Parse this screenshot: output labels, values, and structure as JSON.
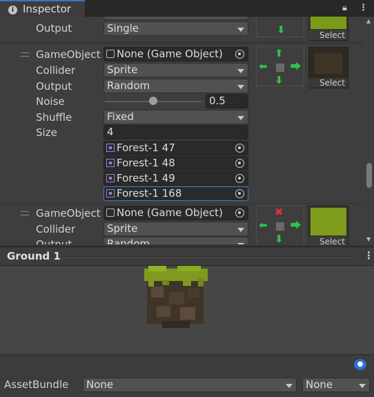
{
  "tab": {
    "title": "Inspector",
    "icon": "info-icon"
  },
  "window_controls": {
    "lock_icon": "lock-icon",
    "menu_icon": "kebab-menu-icon"
  },
  "rule_top": {
    "output_label": "Output",
    "output_value": "Single",
    "preview_button": "Select"
  },
  "rule_1": {
    "gameobject_label": "GameObject",
    "gameobject_value": "None (Game Object)",
    "collider_label": "Collider",
    "collider_value": "Sprite",
    "output_label": "Output",
    "output_value": "Random",
    "noise_label": "Noise",
    "noise_value": "0.5",
    "noise_level": 0.5,
    "shuffle_label": "Shuffle",
    "shuffle_value": "Fixed",
    "size_label": "Size",
    "size_value": "4",
    "sprites": [
      "Forest-1 47",
      "Forest-1 48",
      "Forest-1 49",
      "Forest-1 168"
    ],
    "preview_button": "Select"
  },
  "rule_2": {
    "gameobject_label": "GameObject",
    "gameobject_value": "None (Game Object)",
    "collider_label": "Collider",
    "collider_value": "Sprite",
    "output_label": "Output",
    "output_value": "Random",
    "preview_button": "Select"
  },
  "preview_panel": {
    "title": "Ground 1"
  },
  "asset_bundle": {
    "label": "AssetBundle",
    "name_value": "None",
    "variant_value": "None"
  },
  "colors": {
    "accent": "#3a79bb",
    "arrow_green": "#2fc24a",
    "x_red": "#e0303a",
    "moss": "#8fae1f"
  }
}
